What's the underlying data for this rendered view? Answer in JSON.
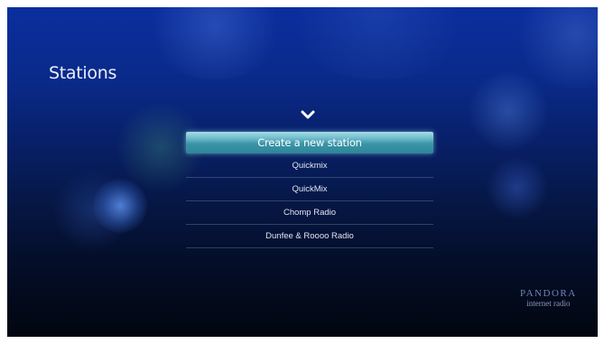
{
  "page": {
    "title": "Stations"
  },
  "stations": {
    "items": [
      {
        "label": "Create a new station"
      },
      {
        "label": "Quickmix"
      },
      {
        "label": "QuickMix"
      },
      {
        "label": "Chomp Radio"
      },
      {
        "label": "Dunfee & Roooo Radio"
      }
    ]
  },
  "brand": {
    "name": "PANDORA",
    "tagline": "internet radio"
  },
  "icons": {
    "scroll_up": "chevron-down-icon"
  },
  "colors": {
    "selection": "#5fb3c4",
    "background_top": "#0a2e9e",
    "background_bottom": "#02060f"
  }
}
